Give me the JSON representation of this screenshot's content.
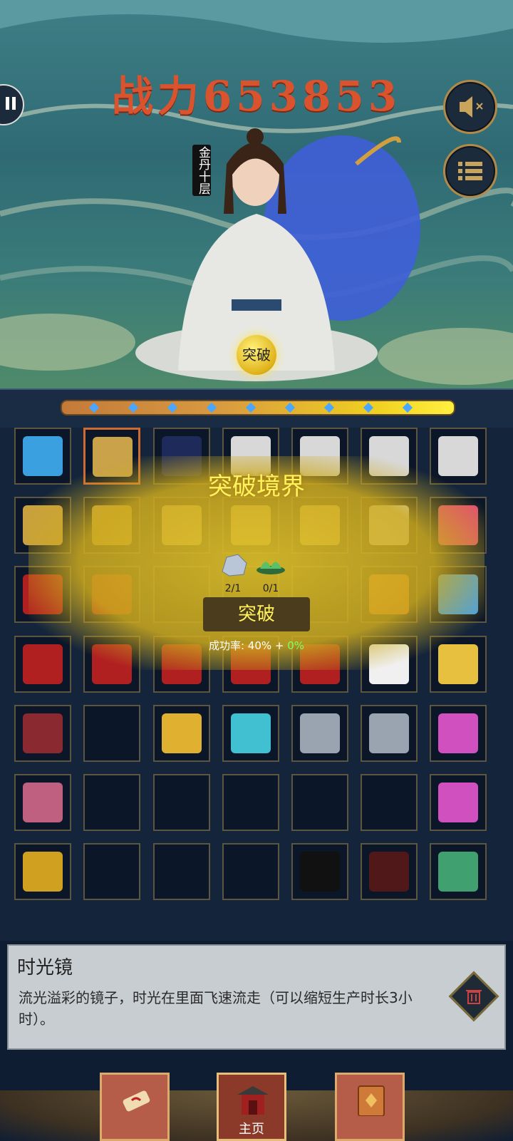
{
  "header": {
    "power_text": "战力653853",
    "rank_text": "金丹十层",
    "breakthrough_orb_label": "突破"
  },
  "icons": {
    "pause": "pause-icon",
    "sound": "sound-off-icon",
    "menu": "list-menu-icon"
  },
  "popup": {
    "title": "突破境界",
    "requirements": [
      {
        "item": "crystal-ore",
        "count": "2/1"
      },
      {
        "item": "green-lotus",
        "count": "0/1"
      }
    ],
    "confirm_label": "突破",
    "success_label": "成功率:",
    "success_value": "40%",
    "plus": "+",
    "bonus_value": "0%"
  },
  "inventory": {
    "rows": [
      [
        "vortex",
        "mirror",
        "dark-box",
        "cloth-white",
        "cloth-white",
        "cloth-white",
        "cloth-white"
      ],
      [
        "gourd",
        "gourd",
        "flower",
        "flower",
        "flower",
        "cloth-white",
        "red-crystal"
      ],
      [
        "red-cloth",
        "red-cloth",
        "",
        "",
        "",
        "orange-petal",
        "ice-crystal"
      ],
      [
        "red-cloth",
        "red-cloth",
        "red-cloth",
        "red-cloth",
        "red-cloth",
        "white-silk",
        "gold-ore"
      ],
      [
        "red-gem",
        "",
        "gold-ingot",
        "blue-crystal",
        "silver-ore",
        "silver-ore",
        "pink-gem"
      ],
      [
        "pink-orb",
        "",
        "",
        "",
        "",
        "",
        "pink-gem"
      ],
      [
        "gold-pot",
        "",
        "",
        "",
        "black-panther",
        "spider",
        "green-crystal"
      ]
    ],
    "colors": {
      "vortex": "#3aa0e0",
      "mirror": "#c9a24a",
      "dark-box": "#1e2a5a",
      "cloth-white": "#d8d8d8",
      "gourd": "#c8a040",
      "flower": "#e0c070",
      "red-crystal": "#e05070",
      "red-cloth": "#b02020",
      "orange-petal": "#e07030",
      "ice-crystal": "#40a0f0",
      "white-silk": "#f0f0f0",
      "gold-ore": "#e8c040",
      "red-gem": "#8a2a30",
      "gold-ingot": "#e0b030",
      "blue-crystal": "#40c0d0",
      "silver-ore": "#9aa4b0",
      "pink-gem": "#d050c0",
      "pink-orb": "#c06080",
      "gold-pot": "#d0a020",
      "black-panther": "#111111",
      "spider": "#501818",
      "green-crystal": "#40a070"
    }
  },
  "description": {
    "name": "时光镜",
    "text": "流光溢彩的镜子，时光在里面飞速流走（可以缩短生产时长3小时）。"
  },
  "tabs": [
    {
      "name": "scroll-tab",
      "label": ""
    },
    {
      "name": "home-tab",
      "label": "主页"
    },
    {
      "name": "book-tab",
      "label": ""
    }
  ]
}
